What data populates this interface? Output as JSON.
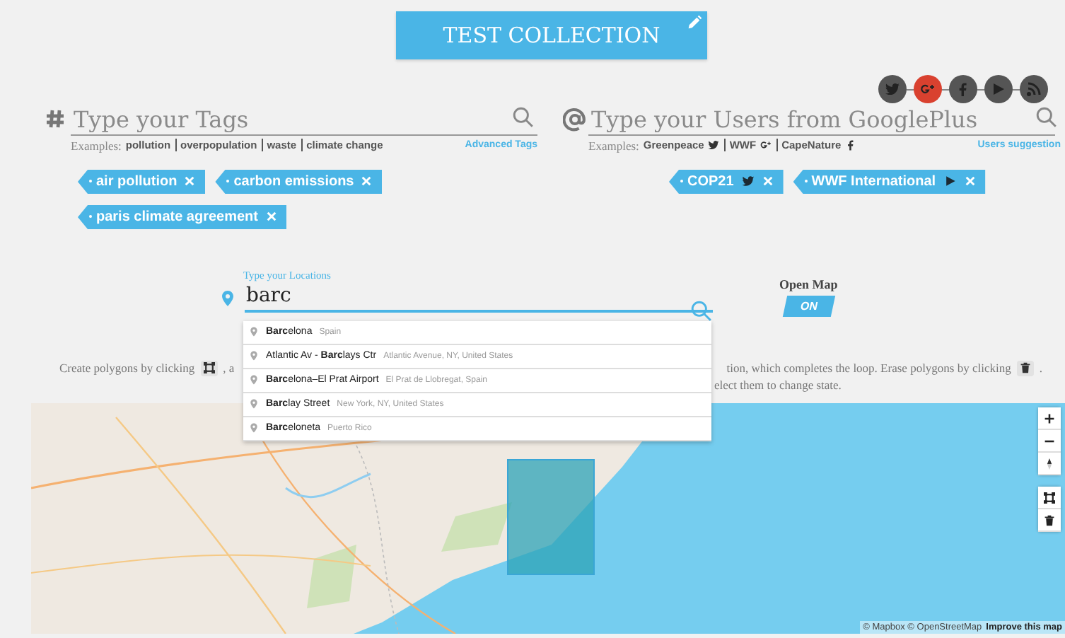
{
  "title_button": {
    "label": "TEST COLLECTION"
  },
  "social_links": [
    {
      "kind": "twitter",
      "selected": false
    },
    {
      "kind": "gplus",
      "selected": true
    },
    {
      "kind": "facebook",
      "selected": false
    },
    {
      "kind": "youtube",
      "selected": false
    },
    {
      "kind": "rss",
      "selected": false
    }
  ],
  "tag_search": {
    "placeholder": "Type your Tags",
    "examples_label": "Examples:",
    "examples": [
      {
        "label": "pollution"
      },
      {
        "label": "overpopulation"
      },
      {
        "label": "waste"
      },
      {
        "label": "climate change"
      }
    ],
    "link": "Advanced Tags"
  },
  "user_search": {
    "placeholder": "Type your Users from GooglePlus",
    "examples_label": "Examples:",
    "examples": [
      {
        "label": "Greenpeace",
        "kind": "twitter"
      },
      {
        "label": "WWF",
        "kind": "gplus"
      },
      {
        "label": "CapeNature",
        "kind": "facebook"
      }
    ],
    "link": "Users suggestion"
  },
  "tags": [
    {
      "label": "air pollution"
    },
    {
      "label": "carbon emissions"
    },
    {
      "label": "paris climate agreement"
    }
  ],
  "users": [
    {
      "label": "COP21",
      "kind": "twitter"
    },
    {
      "label": "WWF International",
      "kind": "youtube"
    }
  ],
  "location": {
    "label": "Type your Locations",
    "value": "barc",
    "suggestions": [
      {
        "name": "**Barc**elona",
        "detail": "Spain"
      },
      {
        "name": "Atlantic Av - **Barc**lays Ctr",
        "detail": "Atlantic Avenue, NY, United States"
      },
      {
        "name": "**Barc**elona–El Prat Airport",
        "detail": "El Prat de Llobregat, Spain"
      },
      {
        "name": "**Barc**lay Street",
        "detail": "New York, NY, United States"
      },
      {
        "name": "**Barc**eloneta",
        "detail": "Puerto Rico"
      }
    ]
  },
  "open_map": {
    "label": "Open Map",
    "button": "ON",
    "on": true
  },
  "help": {
    "left": "Create polygons by clicking",
    "left_after": ", a",
    "right": "tion, which completes the loop. Erase polygons by clicking",
    "right_after": ".",
    "right_line2": "elect them to change state."
  },
  "map": {
    "kind": "picture",
    "attribution": "© Mapbox © OpenStreetMap",
    "link": "Improve this map"
  }
}
